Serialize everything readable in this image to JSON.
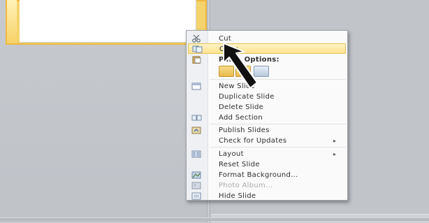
{
  "colors": {
    "selection_fill": "#f4d36c",
    "menu_highlight": "#fde38f",
    "menu_background": "#fafafa",
    "disabled_text": "#a9abae"
  },
  "menu": {
    "cut": "Cut",
    "copy": "Copy",
    "paste_options": "Paste Options:",
    "new_slide": "New Slide",
    "duplicate_slide": "Duplicate Slide",
    "delete_slide": "Delete Slide",
    "add_section": "Add Section",
    "publish_slides": "Publish Slides",
    "check_for_updates": "Check for Updates",
    "layout": "Layout",
    "reset_slide": "Reset Slide",
    "format_background": "Format Background...",
    "photo_album": "Photo Album...",
    "hide_slide": "Hide Slide",
    "submenu_arrow": "▸"
  },
  "icons": {
    "cut": "scissors-icon",
    "copy": "copy-icon",
    "paste": "paste-icon",
    "new_slide": "new-slide-icon",
    "add_section": "section-icon",
    "publish": "publish-icon",
    "layout": "layout-icon",
    "format_background": "background-icon",
    "photo_album": "photo-album-icon",
    "hide_slide": "hide-slide-icon",
    "cursor": "arrow-cursor-icon"
  }
}
